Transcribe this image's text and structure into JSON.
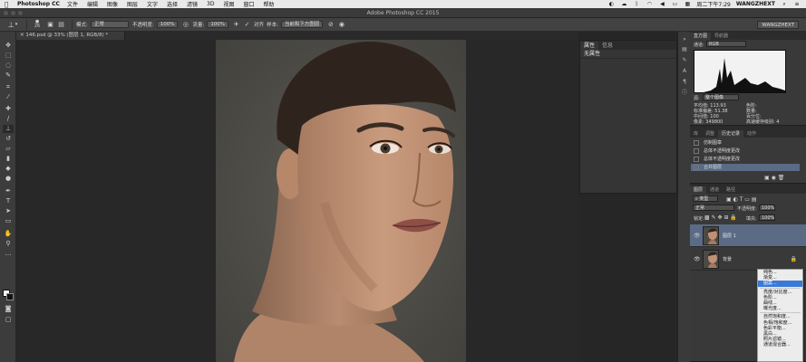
{
  "menubar": {
    "app_name": "Photoshop CC",
    "items": [
      "文件",
      "编辑",
      "图像",
      "图层",
      "文字",
      "选择",
      "滤镜",
      "3D",
      "视图",
      "窗口",
      "帮助"
    ],
    "datetime": "周二下午7:29",
    "user": "WANGZHEXT",
    "apple_icon": "apple-icon"
  },
  "window": {
    "title": "Adobe Photoshop CC 2015"
  },
  "optbar": {
    "mode_label": "模式:",
    "mode_value": "正常",
    "opacity_label": "不透明度:",
    "opacity_value": "100%",
    "flow_label": "流量:",
    "flow_value": "100%",
    "align_label": "对齐",
    "sample_label": "样本:",
    "sample_value": "当前和下方图层",
    "brush_size": "26",
    "workspace": "WANGZHEXT"
  },
  "document": {
    "tab_label": "146.psd @ 33% (图层 1, RGB/8) *"
  },
  "properties": {
    "tabs": [
      "属性",
      "信息"
    ],
    "header": "无属性"
  },
  "histogram": {
    "tabs": [
      "直方图",
      "导航器"
    ],
    "channel_label": "通道:",
    "channel_value": "RGB",
    "source_label": "源:",
    "source_value": "整个图像",
    "stats_left": [
      {
        "label": "平均值:",
        "value": "113.93"
      },
      {
        "label": "标准偏差:",
        "value": "51.38"
      },
      {
        "label": "中间值:",
        "value": "100"
      },
      {
        "label": "像素:",
        "value": "349800"
      }
    ],
    "stats_right": [
      {
        "label": "色阶:",
        "value": ""
      },
      {
        "label": "数量:",
        "value": ""
      },
      {
        "label": "百分位:",
        "value": ""
      },
      {
        "label": "高速缓存级别:",
        "value": "4"
      }
    ]
  },
  "history": {
    "tabs": [
      "库",
      "调整",
      "历史记录",
      "动作"
    ],
    "items": [
      "仿制图章",
      "总体不透明度更改",
      "总体不透明度更改",
      "合并图层"
    ]
  },
  "layers": {
    "tabs": [
      "图层",
      "通道",
      "路径"
    ],
    "kind_value": "类型",
    "blend_value": "正常",
    "opacity_label": "不透明度:",
    "opacity_value": "100%",
    "lock_label": "锁定:",
    "fill_label": "填充:",
    "fill_value": "100%",
    "items": [
      {
        "name": "图层 1"
      },
      {
        "name": "背景"
      }
    ]
  },
  "context_menu": {
    "items": [
      "纯色...",
      "渐变...",
      "图案...",
      "亮度/对比度...",
      "色阶...",
      "曲线...",
      "曝光度...",
      "自然饱和度...",
      "色相/饱和度...",
      "色彩平衡...",
      "黑白...",
      "照片滤镜...",
      "通道混合器..."
    ],
    "highlighted": "图案..."
  },
  "colors": {
    "accent": "#3a79d6",
    "panel": "#393939",
    "canvas": "#282828"
  }
}
